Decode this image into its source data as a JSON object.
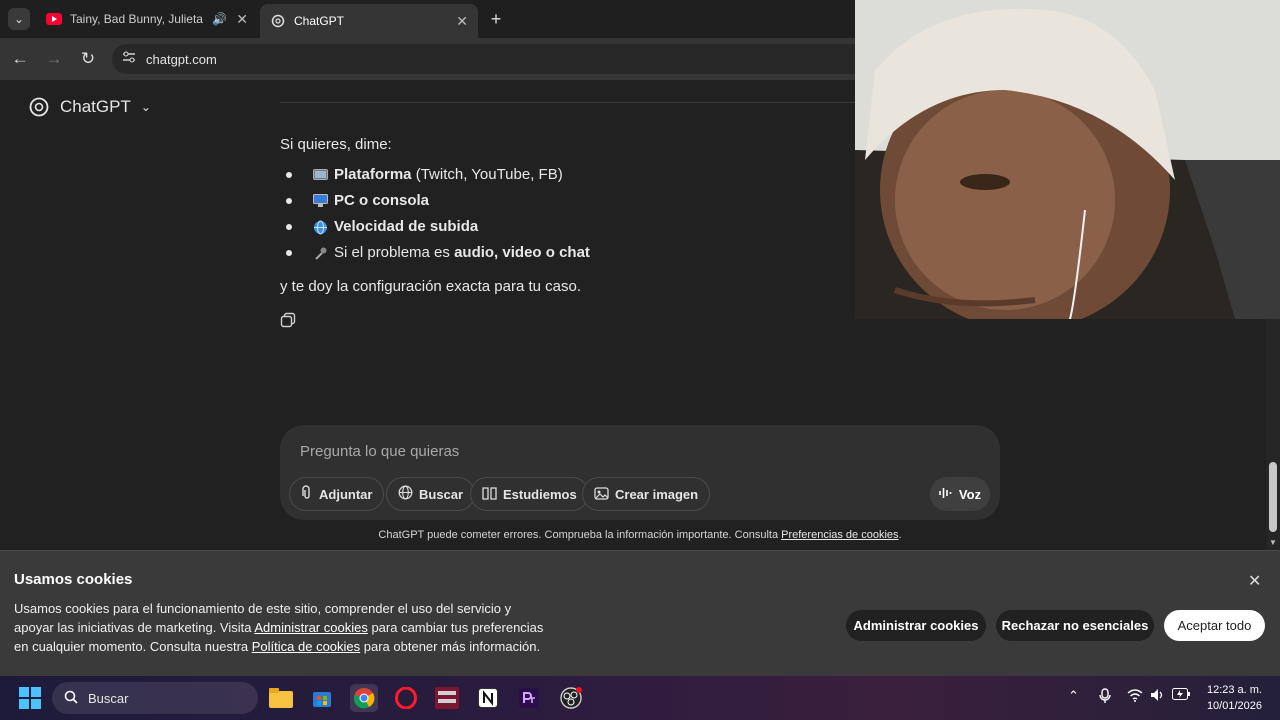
{
  "browser": {
    "tabs": [
      {
        "title": "Tainy, Bad Bunny, Julieta Ve",
        "icon": "youtube-icon",
        "audio": true
      },
      {
        "title": "ChatGPT",
        "icon": "openai-icon",
        "active": true
      }
    ],
    "url": "chatgpt.com"
  },
  "header": {
    "brand": "ChatGPT"
  },
  "message": {
    "intro": "Si quieres, dime:",
    "items": [
      {
        "bold": "Plataforma",
        "rest": " (Twitch, YouTube, FB)",
        "icon": "tv-icon"
      },
      {
        "bold": "PC o consola",
        "rest": "",
        "icon": "computer-icon"
      },
      {
        "bold": "Velocidad de subida",
        "rest": "",
        "icon": "globe-icon"
      },
      {
        "pre": "Si el problema es ",
        "bold": "audio, video o chat",
        "icon": "microphone-icon"
      }
    ],
    "outro": "y te doy la configuración exacta para tu caso."
  },
  "composer": {
    "placeholder": "Pregunta lo que quieras",
    "buttons": [
      "Adjuntar",
      "Buscar",
      "Estudiemos",
      "Crear imagen"
    ],
    "voice": "Voz"
  },
  "disclaimer": {
    "text": "ChatGPT puede cometer errores. Comprueba la información importante. Consulta ",
    "link": "Preferencias de cookies",
    "end": "."
  },
  "cookies": {
    "title": "Usamos cookies",
    "line1": "Usamos cookies para el funcionamiento de este sitio, comprender el uso del servicio y",
    "line2a": "apoyar las iniciativas de marketing. Visita ",
    "link1": "Administrar cookies",
    "line2b": " para cambiar tus preferencias",
    "line3a": "en cualquier momento. Consulta nuestra ",
    "link2": "Política de cookies",
    "line3b": " para obtener más información.",
    "buttons": {
      "manage": "Administrar cookies",
      "reject": "Rechazar no esenciales",
      "accept": "Aceptar todo"
    }
  },
  "taskbar": {
    "search": "Buscar",
    "time": "12:23 a. m.",
    "date": "10/01/2026"
  }
}
